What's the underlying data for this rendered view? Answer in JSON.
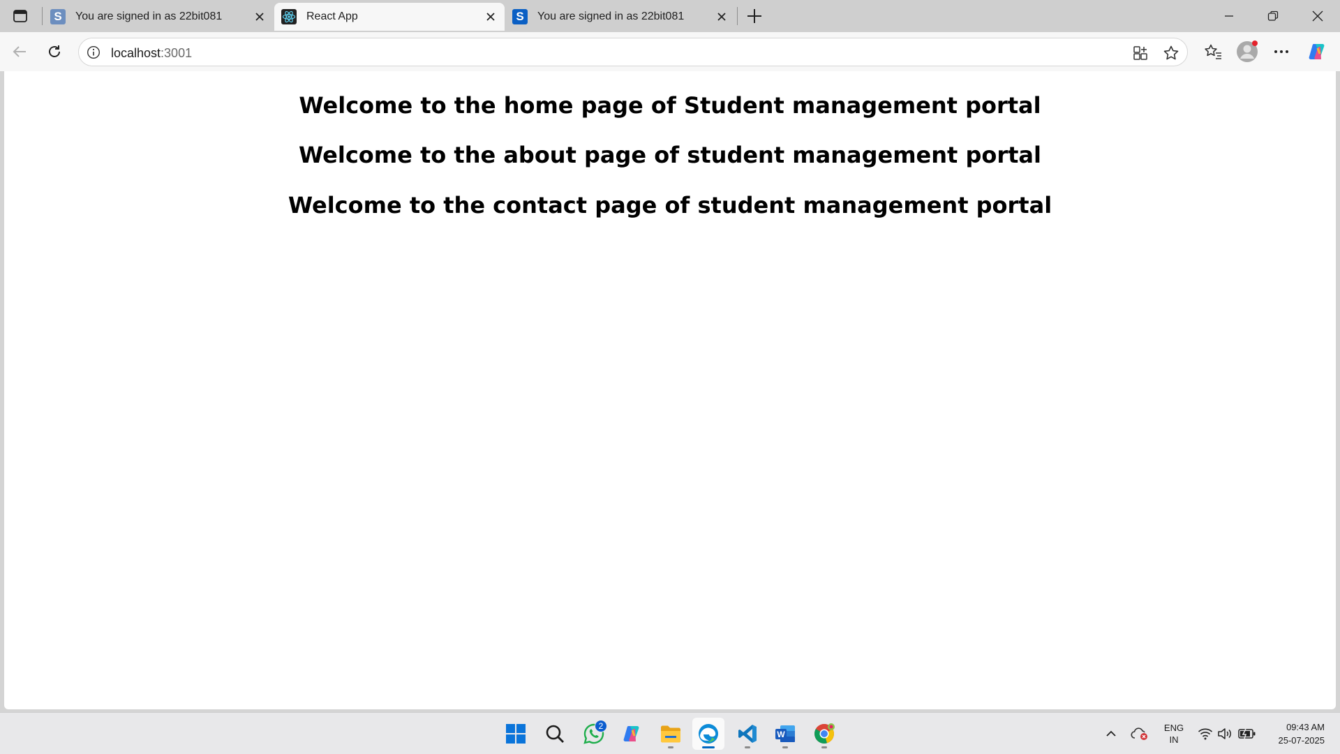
{
  "browser": {
    "tabs": [
      {
        "title": "You are signed in as 22bit081",
        "favicon": "s-logo-icon",
        "active": false
      },
      {
        "title": "React App",
        "favicon": "react-icon",
        "active": true
      },
      {
        "title": "You are signed in as 22bit081",
        "favicon": "s-logo-icon",
        "active": false
      }
    ],
    "favicon_letter": "S",
    "address": {
      "host": "localhost",
      "port": ":3001"
    }
  },
  "page": {
    "headings": [
      "Welcome to the home page of Student management portal",
      "Welcome to the about page of student management portal",
      "Welcome to the contact page of student management portal"
    ]
  },
  "taskbar": {
    "apps": [
      "start",
      "search",
      "whatsapp",
      "copilot",
      "file-explorer",
      "edge",
      "vscode",
      "word",
      "chrome"
    ],
    "whatsapp_badge": "2",
    "language": {
      "line1": "ENG",
      "line2": "IN"
    },
    "time": "09:43 AM",
    "date": "25-07-2025"
  },
  "colors": {
    "tab_strip": "#cfcfcf",
    "toolbar": "#f7f7f7",
    "accent": "#0067c0",
    "favicon_s_inactive": "#6c8ebf",
    "favicon_s_active": "#0a5fc4"
  }
}
